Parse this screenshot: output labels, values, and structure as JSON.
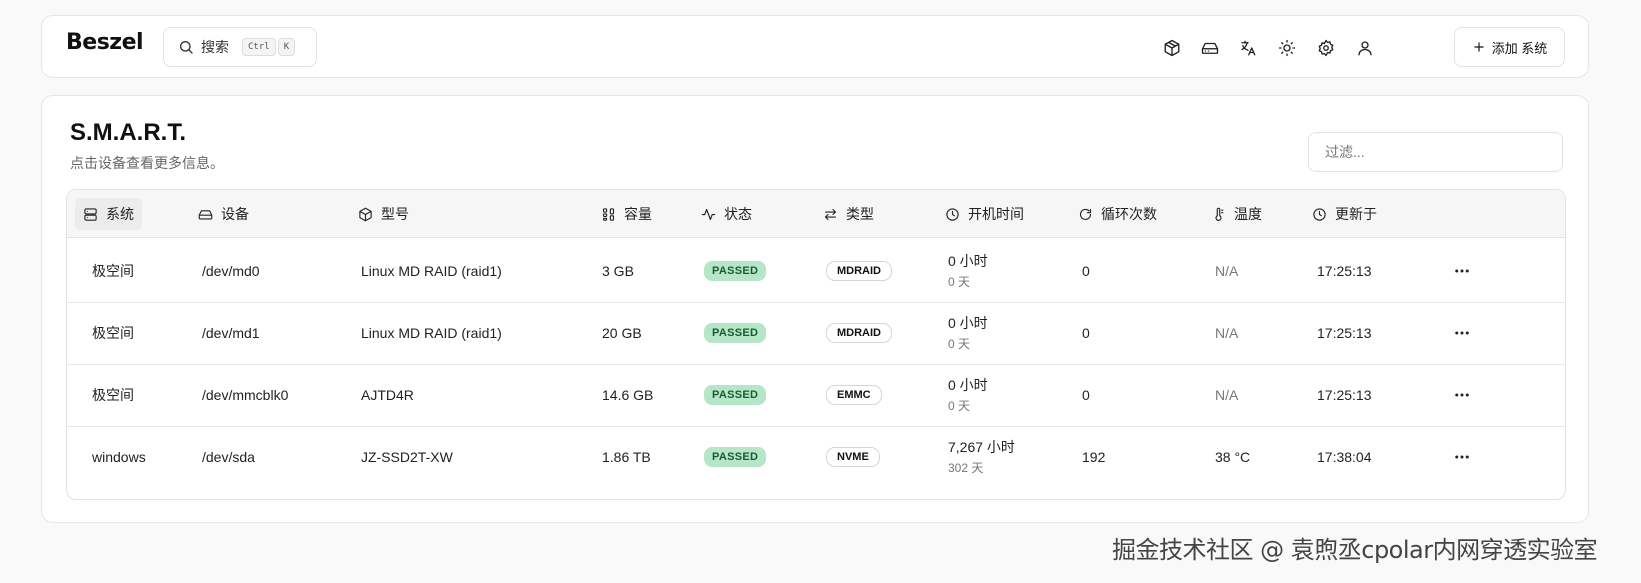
{
  "header": {
    "logo": "Beszel",
    "search": {
      "label": "搜索",
      "kbd": [
        "Ctrl",
        "K"
      ]
    },
    "icons": [
      "cube-icon",
      "hard-drive-icon",
      "translate-icon",
      "sun-icon",
      "gear-icon",
      "user-icon"
    ],
    "add_button": "添加 系统"
  },
  "main": {
    "title": "S.M.A.R.T.",
    "subtitle": "点击设备查看更多信息。",
    "filter_placeholder": "过滤..."
  },
  "table": {
    "columns": [
      "系统",
      "设备",
      "型号",
      "容量",
      "状态",
      "类型",
      "开机时间",
      "循环次数",
      "温度",
      "更新于"
    ],
    "rows": [
      {
        "system": "极空间",
        "device": "/dev/md0",
        "model": "Linux MD RAID (raid1)",
        "capacity": "3 GB",
        "status": "PASSED",
        "type": "MDRAID",
        "uptime_hours": "0 小时",
        "uptime_days": "0 天",
        "cycles": "0",
        "temp": "N/A",
        "updated": "17:25:13"
      },
      {
        "system": "极空间",
        "device": "/dev/md1",
        "model": "Linux MD RAID (raid1)",
        "capacity": "20 GB",
        "status": "PASSED",
        "type": "MDRAID",
        "uptime_hours": "0 小时",
        "uptime_days": "0 天",
        "cycles": "0",
        "temp": "N/A",
        "updated": "17:25:13"
      },
      {
        "system": "极空间",
        "device": "/dev/mmcblk0",
        "model": "AJTD4R",
        "capacity": "14.6 GB",
        "status": "PASSED",
        "type": "EMMC",
        "uptime_hours": "0 小时",
        "uptime_days": "0 天",
        "cycles": "0",
        "temp": "N/A",
        "updated": "17:25:13"
      },
      {
        "system": "windows",
        "device": "/dev/sda",
        "model": "JZ-SSD2T-XW",
        "capacity": "1.86 TB",
        "status": "PASSED",
        "type": "NVME",
        "uptime_hours": "7,267 小时",
        "uptime_days": "302 天",
        "cycles": "192",
        "temp": "38 °C",
        "updated": "17:38:04"
      }
    ]
  },
  "watermark": "掘金技术社区 @ 袁煦丞cpolar内网穿透实验室"
}
